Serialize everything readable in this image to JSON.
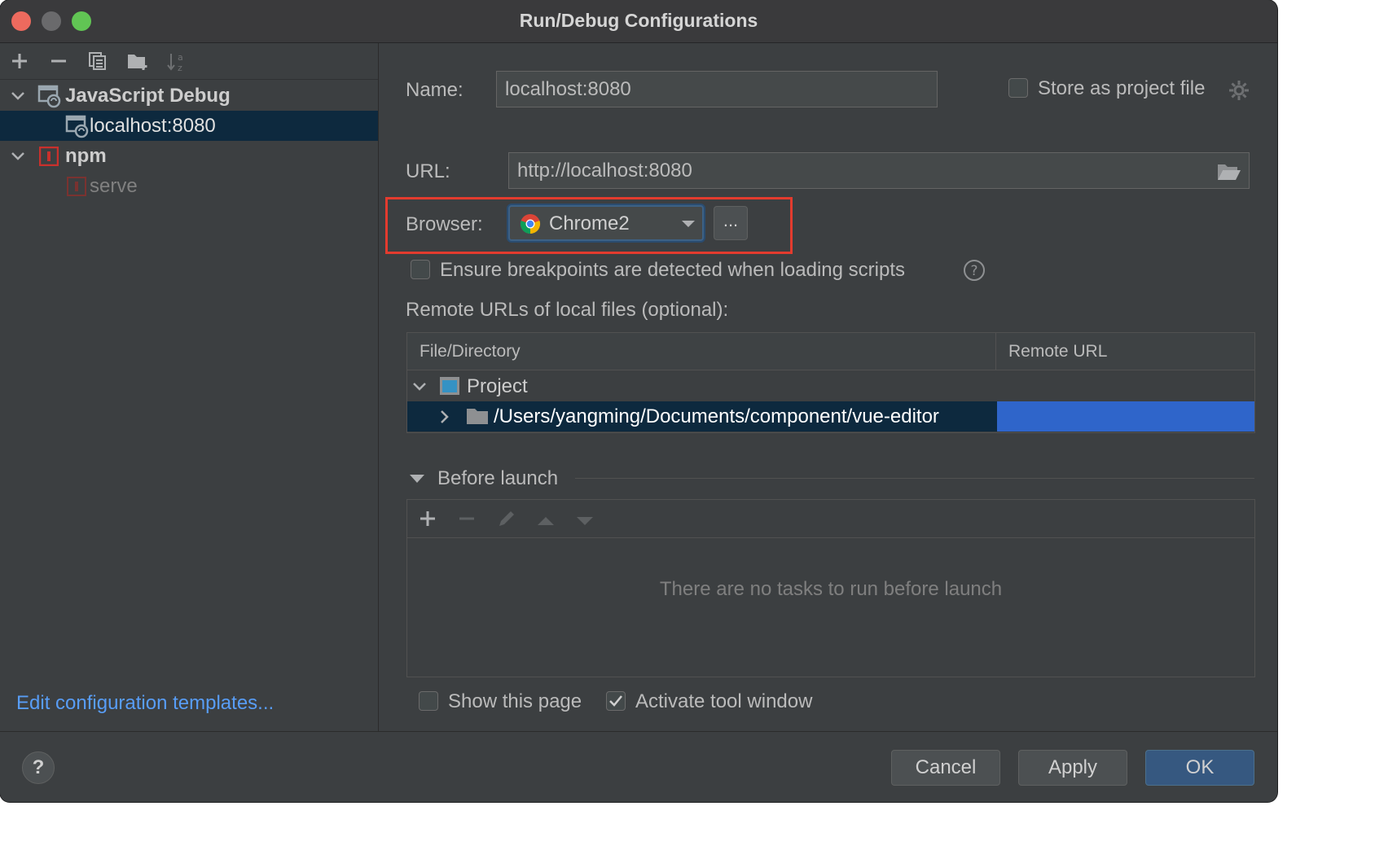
{
  "window": {
    "title": "Run/Debug Configurations"
  },
  "left_toolbar": {
    "icons": [
      "add-icon",
      "remove-icon",
      "copy-icon",
      "folder-add-icon",
      "sort-alpha-icon"
    ]
  },
  "tree": {
    "groups": [
      {
        "label": "JavaScript Debug",
        "icon": "javascript-debug-icon",
        "children": [
          {
            "label": "localhost:8080",
            "icon": "javascript-debug-icon",
            "selected": true
          }
        ]
      },
      {
        "label": "npm",
        "icon": "npm-icon",
        "children": [
          {
            "label": "serve",
            "icon": "npm-icon",
            "selected": false
          }
        ]
      }
    ]
  },
  "edit_templates_link": "Edit configuration templates...",
  "form": {
    "name_label": "Name:",
    "name_value": "localhost:8080",
    "store_project_label": "Store as project file",
    "url_label": "URL:",
    "url_value": "http://localhost:8080",
    "browser_label": "Browser:",
    "browser_value": "Chrome2",
    "browser_more": "...",
    "ensure_breakpoints_label": "Ensure breakpoints are detected when loading scripts",
    "ensure_breakpoints_checked": false,
    "remote_urls_label": "Remote URLs of local files (optional):"
  },
  "remote_table": {
    "columns": [
      "File/Directory",
      "Remote URL"
    ],
    "rows": [
      {
        "label": "Project",
        "icon": "project-icon",
        "expanded": true
      },
      {
        "label": "/Users/yangming/Documents/component/vue-editor",
        "icon": "folder-icon",
        "expanded": false,
        "selected": true
      }
    ]
  },
  "before_launch": {
    "title": "Before launch",
    "empty_message": "There are no tasks to run before launch",
    "toolbar": [
      "add-icon",
      "remove-icon",
      "edit-icon",
      "move-up-icon",
      "move-down-icon"
    ]
  },
  "options": {
    "show_page_label": "Show this page",
    "show_page_checked": false,
    "activate_tool_label": "Activate tool window",
    "activate_tool_checked": true
  },
  "buttons": {
    "help": "?",
    "cancel": "Cancel",
    "apply": "Apply",
    "ok": "OK"
  },
  "colors": {
    "highlight_box": "#e33b2e",
    "selection": "#0d293e",
    "link": "#589df6",
    "remote_url_cell": "#2f65ca"
  }
}
